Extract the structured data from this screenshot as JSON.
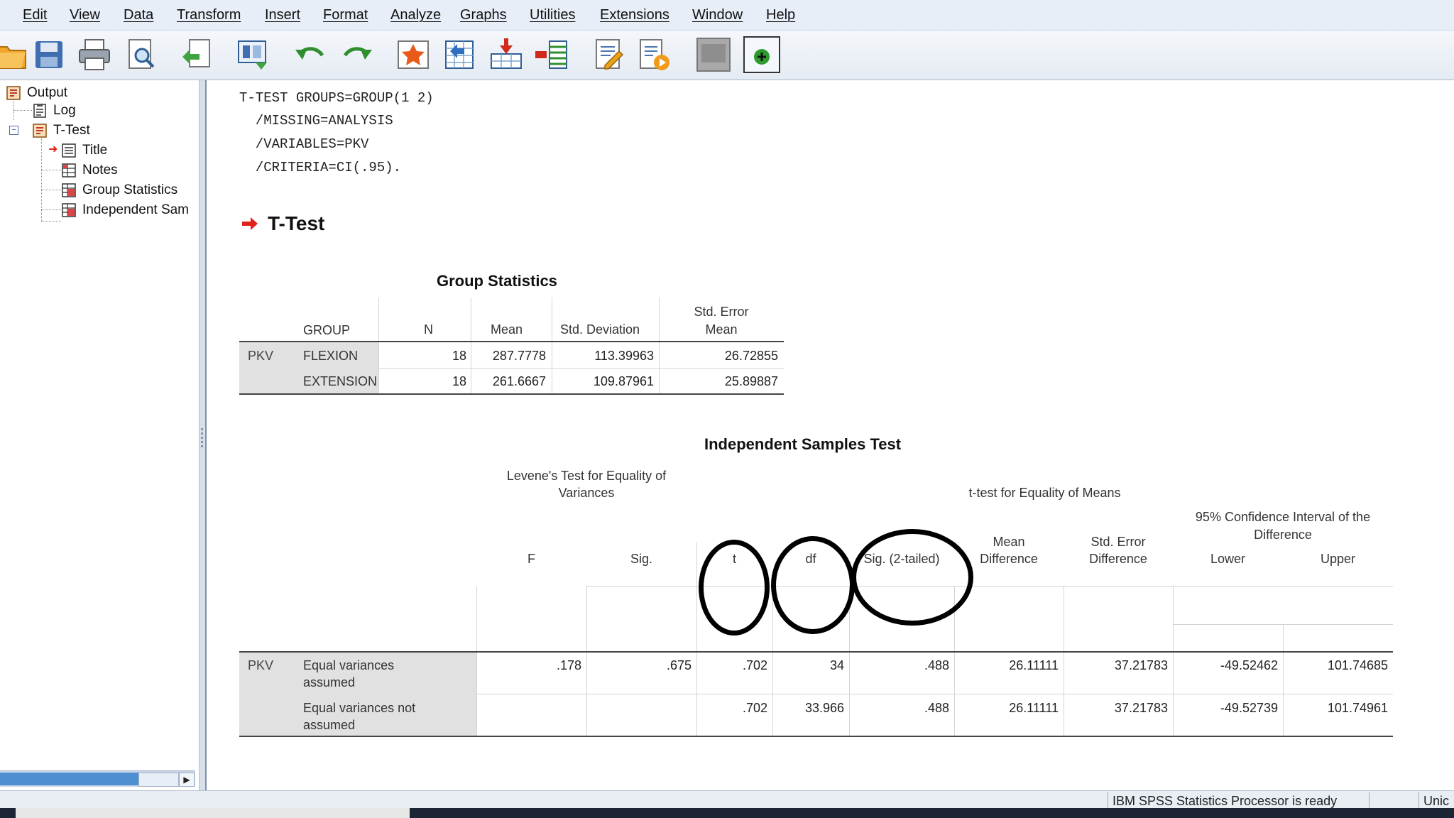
{
  "menu": [
    "Edit",
    "View",
    "Data",
    "Transform",
    "Insert",
    "Format",
    "Analyze",
    "Graphs",
    "Utilities",
    "Extensions",
    "Window",
    "Help"
  ],
  "toolbar": {
    "icons": [
      "open-folder-icon",
      "save-icon",
      "print-icon",
      "print-preview-icon",
      "export-icon",
      "recall-dialog-icon",
      "undo-icon",
      "redo-icon",
      "goto-data-icon",
      "goto-case-icon",
      "goto-variable-icon",
      "variables-icon",
      "edit-script-icon",
      "run-script-icon",
      "hide-icon",
      "insert-output-icon"
    ]
  },
  "navigator": {
    "nodes": [
      {
        "label": "Output",
        "icon": "output-icon"
      },
      {
        "label": "Log",
        "icon": "log-icon"
      },
      {
        "label": "T-Test",
        "icon": "ttest-icon"
      },
      {
        "label": "Title",
        "icon": "title-icon"
      },
      {
        "label": "Notes",
        "icon": "notes-icon"
      },
      {
        "label": "Group Statistics",
        "icon": "table-icon"
      },
      {
        "label": "Independent Sam",
        "icon": "table-icon"
      }
    ]
  },
  "syntax": [
    "T-TEST GROUPS=GROUP(1 2)",
    "  /MISSING=ANALYSIS",
    "  /VARIABLES=PKV",
    "  /CRITERIA=CI(.95)."
  ],
  "heading": "T-Test",
  "group_statistics": {
    "title": "Group Statistics",
    "headers": {
      "group": "GROUP",
      "n": "N",
      "mean": "Mean",
      "sd": "Std. Deviation",
      "sem1": "Std. Error",
      "sem2": "Mean"
    },
    "variable": "PKV",
    "rows": [
      {
        "group": "FLEXION",
        "n": "18",
        "mean": "287.7778",
        "sd": "113.39963",
        "sem": "26.72855"
      },
      {
        "group": "EXTENSION",
        "n": "18",
        "mean": "261.6667",
        "sd": "109.87961",
        "sem": "25.89887"
      }
    ]
  },
  "independent_test": {
    "title": "Independent Samples Test",
    "levene_header1": "Levene's Test for Equality of",
    "levene_header2": "Variances",
    "ttest_header": "t-test for Equality of Means",
    "ci_header1": "95% Confidence Interval of the",
    "ci_header2": "Difference",
    "cols": {
      "f": "F",
      "sig": "Sig.",
      "t": "t",
      "df": "df",
      "sig2": "Sig. (2-tailed)",
      "md1": "Mean",
      "md2": "Difference",
      "sed1": "Std. Error",
      "sed2": "Difference",
      "lower": "Lower",
      "upper": "Upper"
    },
    "variable": "PKV",
    "rows": [
      {
        "label1": "Equal variances",
        "label2": "assumed",
        "f": ".178",
        "sig": ".675",
        "t": ".702",
        "df": "34",
        "sig2": ".488",
        "md": "26.11111",
        "sed": "37.21783",
        "lower": "-49.52462",
        "upper": "101.74685"
      },
      {
        "label1": "Equal variances not",
        "label2": "assumed",
        "f": "",
        "sig": "",
        "t": ".702",
        "df": "33.966",
        "sig2": ".488",
        "md": "26.11111",
        "sed": "37.21783",
        "lower": "-49.52739",
        "upper": "101.74961"
      }
    ]
  },
  "status": {
    "message": "IBM SPSS Statistics Processor is ready",
    "encoding": "Unic"
  },
  "colors": {
    "menubar": "#e7eef7",
    "accent_arrow": "#e0201a",
    "table_shade": "#e1e1e1"
  }
}
